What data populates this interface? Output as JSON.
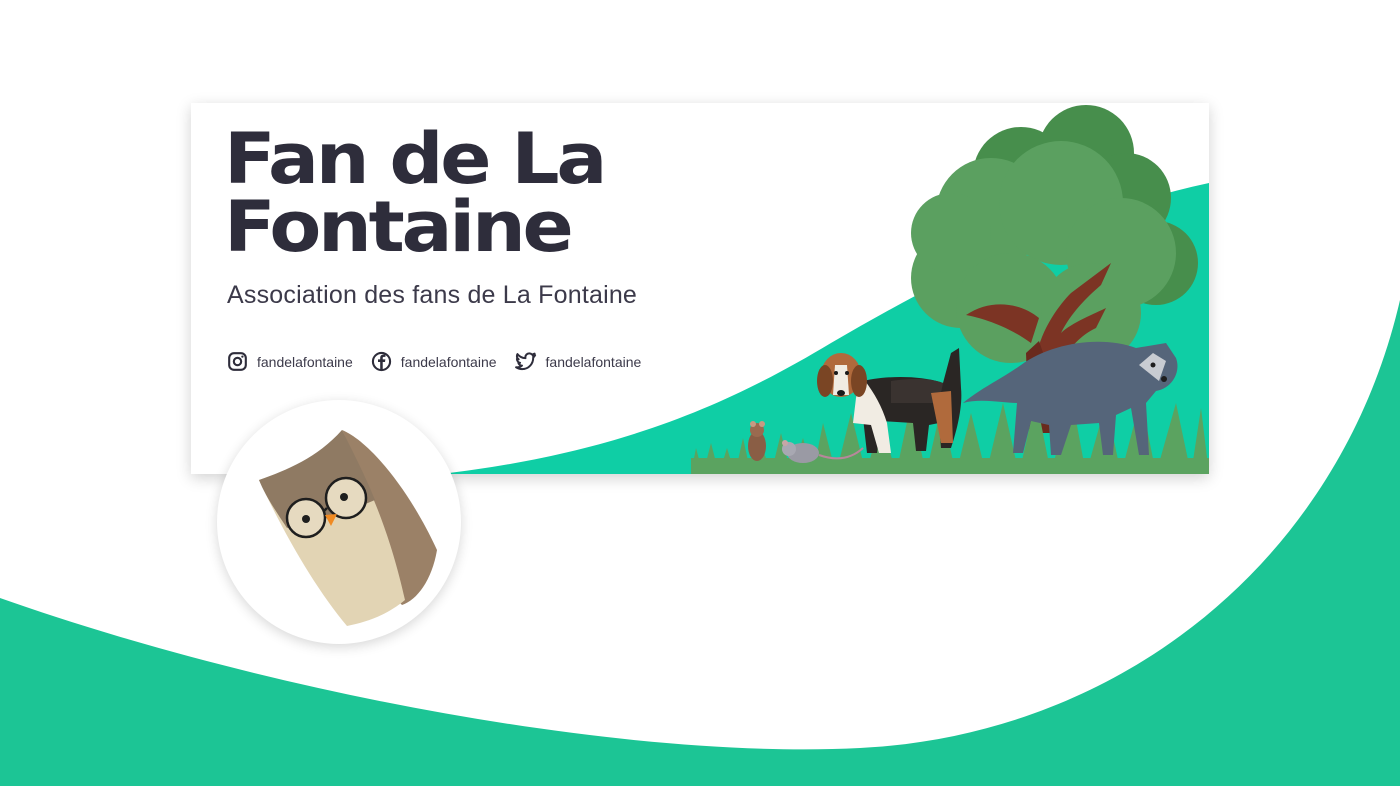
{
  "colors": {
    "accent_green": "#1cc595",
    "banner_green": "#0fcea5",
    "title_dark": "#2e2d3b",
    "tree_green": "#5ba060",
    "owl_light": "#e2d4b4",
    "owl_dark": "#9b8167"
  },
  "banner": {
    "title_line1": "Fan de La",
    "title_line2": "Fontaine",
    "subtitle": "Association des fans de La Fontaine",
    "socials": [
      {
        "icon": "instagram-icon",
        "handle": "fandelafontaine"
      },
      {
        "icon": "facebook-icon",
        "handle": "fandelafontaine"
      },
      {
        "icon": "twitter-icon",
        "handle": "fandelafontaine"
      }
    ],
    "illustration": [
      "tree",
      "beagle-dog",
      "wolf",
      "mouse",
      "rat",
      "grass"
    ]
  },
  "avatar": {
    "icon": "owl-icon"
  }
}
